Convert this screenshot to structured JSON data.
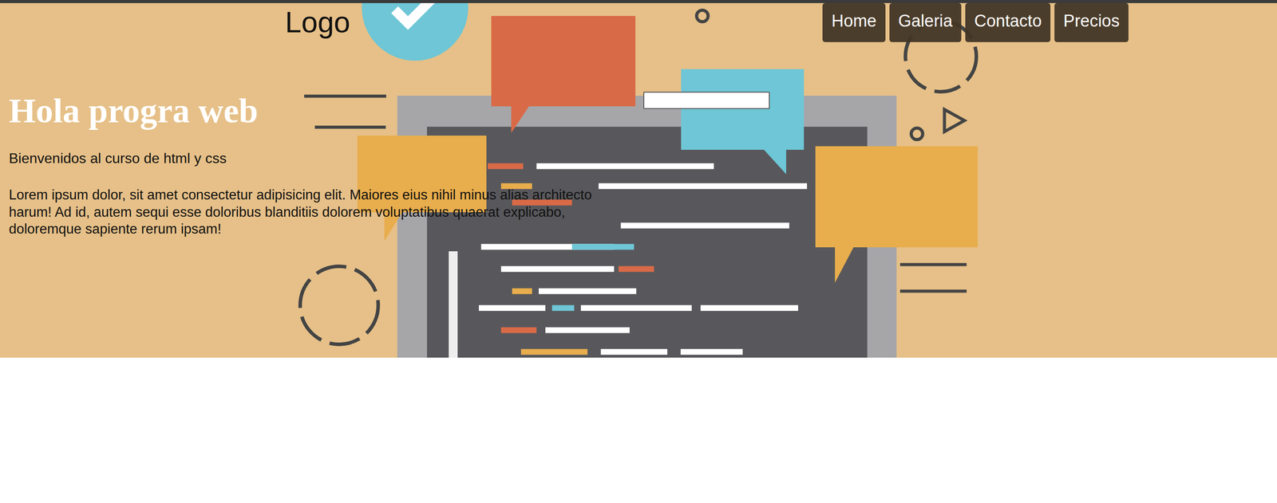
{
  "header": {
    "logo": "Logo"
  },
  "nav": [
    {
      "label": "Home"
    },
    {
      "label": "Galeria"
    },
    {
      "label": "Contacto"
    },
    {
      "label": "Precios"
    }
  ],
  "hero": {
    "title": "Hola progra web",
    "subtitle": "Bienvenidos al curso de html y css",
    "body": "Lorem ipsum dolor, sit amet consectetur adipisicing elit. Maiores eius nihil minus alias architecto harum! Ad id, autem sequi esse doloribus blanditiis dolorem voluptatibus quaerat explicabo, doloremque sapiente rerum ipsam!"
  }
}
